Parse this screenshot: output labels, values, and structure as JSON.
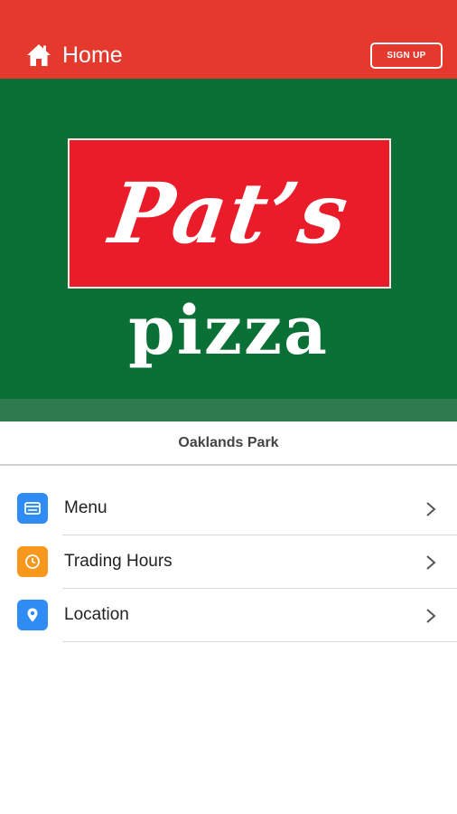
{
  "header": {
    "title": "Home",
    "signup_label": "SIGN UP",
    "home_icon": "home-icon",
    "background": "#e5392e"
  },
  "hero": {
    "logo_script": "Pat’s",
    "logo_word": "pizza",
    "background": "#0a7036",
    "logo_box_color": "#ea1c2a"
  },
  "location": {
    "name": "Oaklands Park"
  },
  "nav": {
    "items": [
      {
        "label": "Menu",
        "icon": "menu-icon",
        "icon_color": "#2f8cf4"
      },
      {
        "label": "Trading Hours",
        "icon": "clock-icon",
        "icon_color": "#f7981d"
      },
      {
        "label": "Location",
        "icon": "map-pin-icon",
        "icon_color": "#2f8cf4"
      }
    ]
  }
}
